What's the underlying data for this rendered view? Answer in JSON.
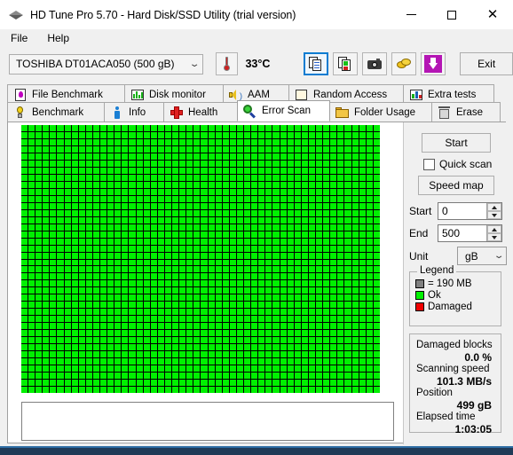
{
  "window": {
    "title": "HD Tune Pro 5.70 - Hard Disk/SSD Utility (trial version)",
    "icon": "harddisk-icon",
    "minimize_label": "Minimize",
    "maximize_label": "Maximize",
    "close_label": "Close"
  },
  "menu": {
    "items": [
      {
        "label": "File"
      },
      {
        "label": "Help"
      }
    ]
  },
  "toolbar": {
    "drive": {
      "selected": "TOSHIBA DT01ACA050 (500 gB)",
      "chevron": "chevron-down-icon"
    },
    "temperature": "33°C",
    "thermometer_icon": "thermometer-icon",
    "buttons": [
      {
        "name": "copy-to-clipboard-button",
        "icon": "copy-document-icon",
        "selected": true
      },
      {
        "name": "copy-image-button",
        "icon": "copy-image-icon",
        "selected": false
      },
      {
        "name": "screenshot-button",
        "icon": "camera-icon",
        "selected": false
      },
      {
        "name": "coins-button",
        "icon": "coins-icon",
        "selected": false
      },
      {
        "name": "download-button",
        "icon": "download-arrow-icon",
        "selected": false
      }
    ],
    "exit_label": "Exit"
  },
  "tabs": {
    "row1": [
      {
        "label": "File Benchmark",
        "icon": "file-benchmark-icon",
        "active": false
      },
      {
        "label": "Disk monitor",
        "icon": "disk-monitor-icon",
        "active": false
      },
      {
        "label": "AAM",
        "icon": "speaker-icon",
        "active": false
      },
      {
        "label": "Random Access",
        "icon": "random-access-icon",
        "active": false
      },
      {
        "label": "Extra tests",
        "icon": "extra-tests-icon",
        "active": false
      }
    ],
    "row2": [
      {
        "label": "Benchmark",
        "icon": "lightbulb-icon",
        "active": false
      },
      {
        "label": "Info",
        "icon": "info-icon",
        "active": false
      },
      {
        "label": "Health",
        "icon": "red-cross-icon",
        "active": false
      },
      {
        "label": "Error Scan",
        "icon": "magnifier-icon",
        "active": true
      },
      {
        "label": "Folder Usage",
        "icon": "folder-icon",
        "active": false
      },
      {
        "label": "Erase",
        "icon": "trash-icon",
        "active": false
      }
    ]
  },
  "scan": {
    "start_button": "Start",
    "quick_scan_label": "Quick scan",
    "quick_scan_checked": false,
    "speed_map_button": "Speed map",
    "start_label": "Start",
    "start_value": "0",
    "end_label": "End",
    "end_value": "500",
    "unit_label": "Unit",
    "unit_value": "gB",
    "unit_chevron": "chevron-down-icon"
  },
  "legend": {
    "title": "Legend",
    "block_size": "= 190 MB",
    "block_color": "#808080",
    "ok_label": "Ok",
    "ok_color": "#00f000",
    "damaged_label": "Damaged",
    "damaged_color": "#f00000"
  },
  "stats": {
    "damaged_blocks_label": "Damaged blocks",
    "damaged_blocks_value": "0.0 %",
    "scanning_speed_label": "Scanning speed",
    "scanning_speed_value": "101.3 MB/s",
    "position_label": "Position",
    "position_value": "499 gB",
    "elapsed_time_label": "Elapsed time",
    "elapsed_time_value": "1:03:05"
  },
  "blockmap": {
    "columns": 50,
    "rows": 38,
    "ok_color": "#00f000",
    "grid_color": "#000000",
    "log_text": ""
  }
}
